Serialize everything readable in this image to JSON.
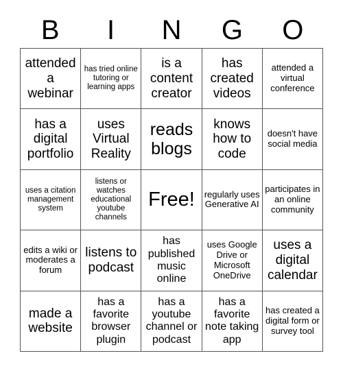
{
  "header": {
    "letters": [
      "B",
      "I",
      "N",
      "G",
      "O"
    ]
  },
  "colors": {
    "background": "#ffffff",
    "text": "#000000",
    "grid_line": "#555555"
  },
  "grid": {
    "columns": 5,
    "rows": 5,
    "cells": [
      {
        "text": "attended a webinar",
        "size": "lg"
      },
      {
        "text": "has tried online tutoring or learning apps",
        "size": "xs"
      },
      {
        "text": "is a content creator",
        "size": "lg"
      },
      {
        "text": "has created videos",
        "size": "lg"
      },
      {
        "text": "attended a virtual conference",
        "size": "sm"
      },
      {
        "text": "has a digital portfolio",
        "size": "lg"
      },
      {
        "text": "uses Virtual Reality",
        "size": "lg"
      },
      {
        "text": "reads blogs",
        "size": "xl"
      },
      {
        "text": "knows how to code",
        "size": "lg"
      },
      {
        "text": "doesn't have social media",
        "size": "sm"
      },
      {
        "text": "uses a citation management system",
        "size": "xs"
      },
      {
        "text": "listens or watches educational youtube channels",
        "size": "xs"
      },
      {
        "text": "Free!",
        "size": "xxl"
      },
      {
        "text": "regularly uses Generative AI",
        "size": "sm"
      },
      {
        "text": "participates in an online community",
        "size": "sm"
      },
      {
        "text": "edits a wiki or moderates a forum",
        "size": "sm"
      },
      {
        "text": "listens to podcast",
        "size": "lg"
      },
      {
        "text": "has published music online",
        "size": "md"
      },
      {
        "text": "uses Google Drive or Microsoft OneDrive",
        "size": "sm"
      },
      {
        "text": "uses a digital calendar",
        "size": "lg"
      },
      {
        "text": "made a website",
        "size": "lg"
      },
      {
        "text": "has a favorite browser plugin",
        "size": "md"
      },
      {
        "text": "has a youtube channel or podcast",
        "size": "md"
      },
      {
        "text": "has a favorite note taking app",
        "size": "md"
      },
      {
        "text": "has created a digital form or survey tool",
        "size": "sm"
      }
    ]
  }
}
